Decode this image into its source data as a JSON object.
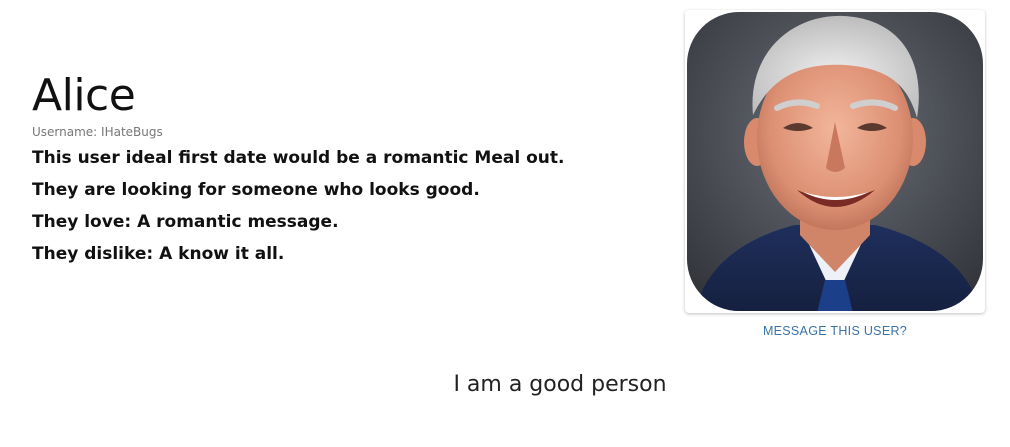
{
  "profile": {
    "name": "Alice",
    "username_label": "Username: IHateBugs",
    "bio": [
      "This user ideal first date would be a romantic Meal out.",
      "They are looking for someone who looks good.",
      "They love: A romantic message.",
      "They dislike: A know it all."
    ]
  },
  "actions": {
    "message_link": "MESSAGE THIS USER?"
  },
  "footer": {
    "motto": "I am a good person"
  },
  "colors": {
    "link": "#3a73a8",
    "text": "#111111",
    "muted": "#777777"
  }
}
